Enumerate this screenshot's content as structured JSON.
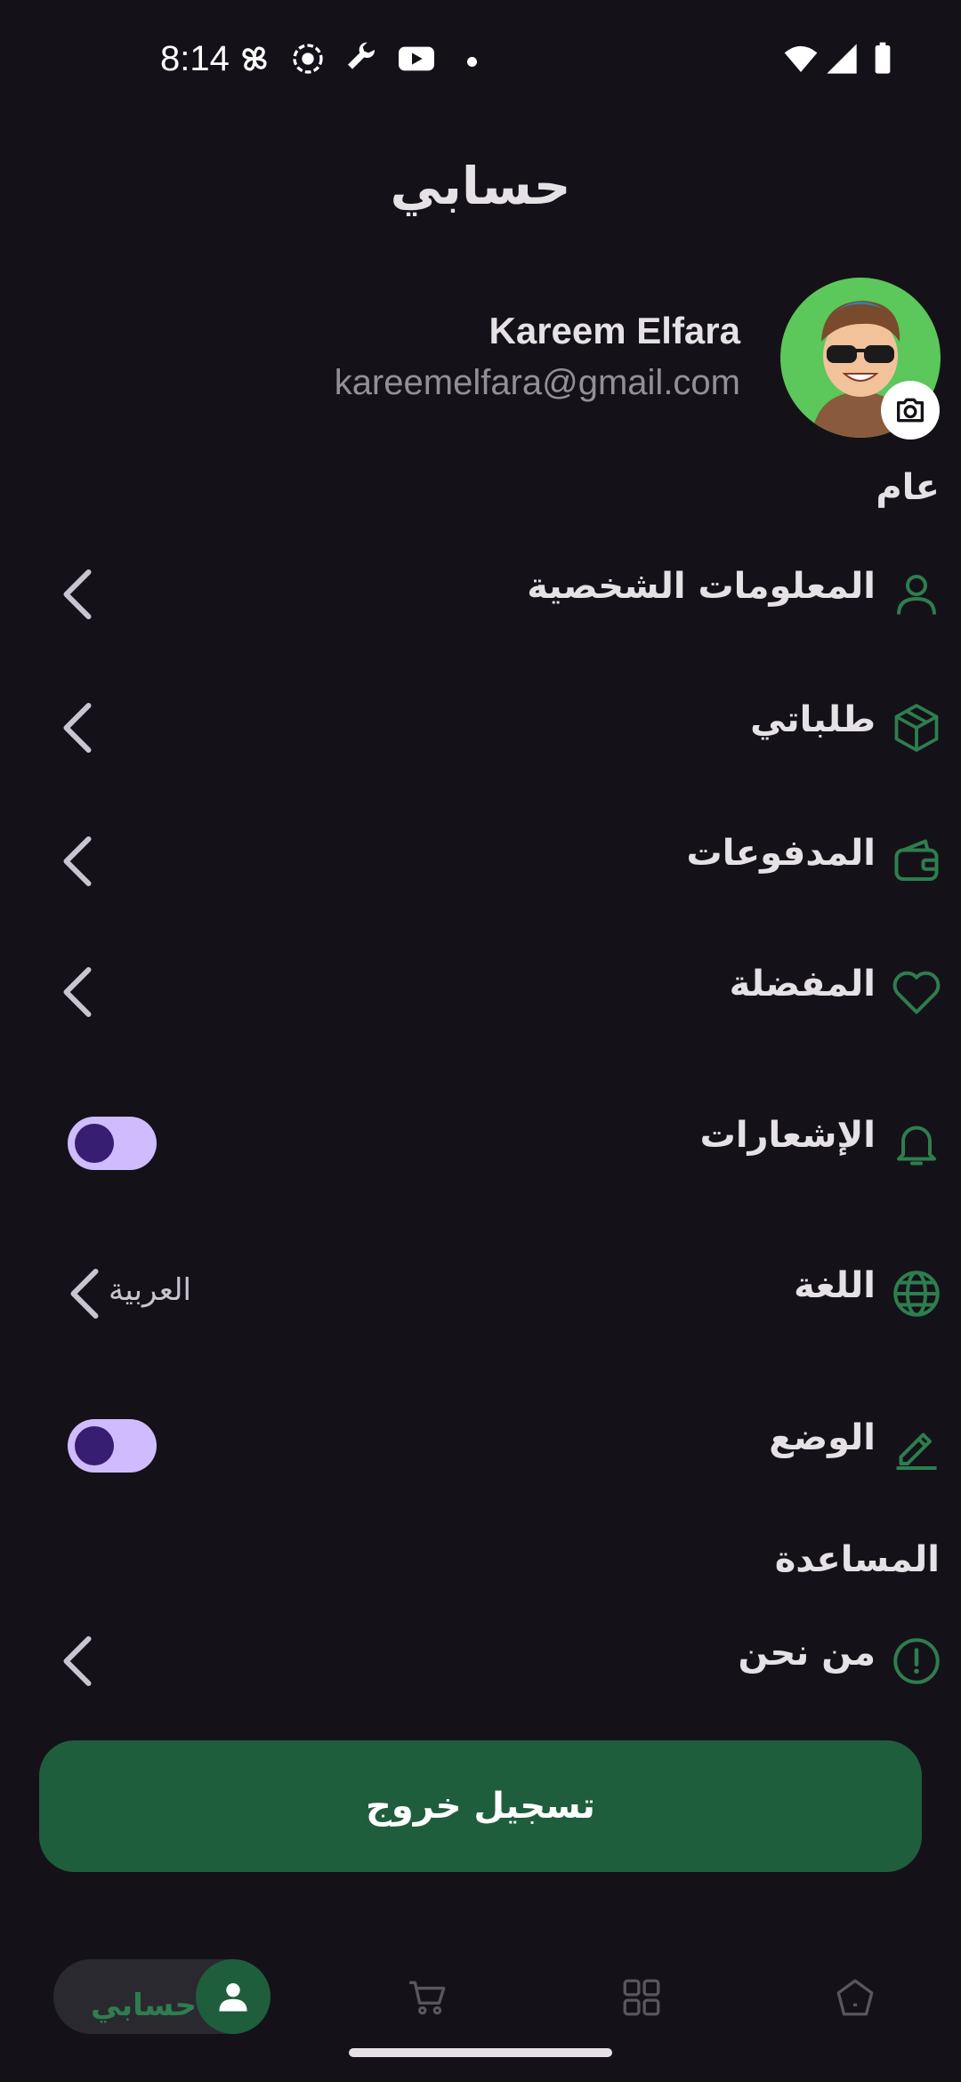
{
  "status_bar": {
    "time": "8:14",
    "icons": [
      "pinwheel-icon",
      "record-icon",
      "wrench-icon",
      "youtube-icon",
      "dot-icon",
      "wifi-icon",
      "signal-icon",
      "battery-icon"
    ]
  },
  "header": {
    "title": "حسابي"
  },
  "profile": {
    "name": "Kareem Elfara",
    "email": "kareemelfara@gmail.com"
  },
  "sections": {
    "general": "عام",
    "help": "المساعدة"
  },
  "menu": {
    "personal_info": {
      "label": "المعلومات الشخصية",
      "icon": "person-icon"
    },
    "orders": {
      "label": "طلباتي",
      "icon": "box-icon"
    },
    "payments": {
      "label": "المدفوعات",
      "icon": "wallet-icon"
    },
    "favorites": {
      "label": "المفضلة",
      "icon": "heart-icon"
    },
    "notifications": {
      "label": "الإشعارات",
      "icon": "bell-icon",
      "enabled": true
    },
    "language": {
      "label": "اللغة",
      "icon": "globe-icon",
      "value": "العربية"
    },
    "mode": {
      "label": "الوضع",
      "icon": "pen-icon",
      "enabled": true
    },
    "about": {
      "label": "من نحن",
      "icon": "info-icon"
    }
  },
  "logout": {
    "label": "تسجيل خروج"
  },
  "bottom_nav": {
    "active_label": "حسابي",
    "items": [
      "account-icon",
      "cart-icon",
      "grid-icon",
      "home-icon"
    ]
  },
  "colors": {
    "background": "#141218",
    "accent_green": "#1f5e3c",
    "icon_green": "#2e7d4f",
    "toggle_track": "#cfbcff",
    "toggle_knob": "#381e72"
  }
}
